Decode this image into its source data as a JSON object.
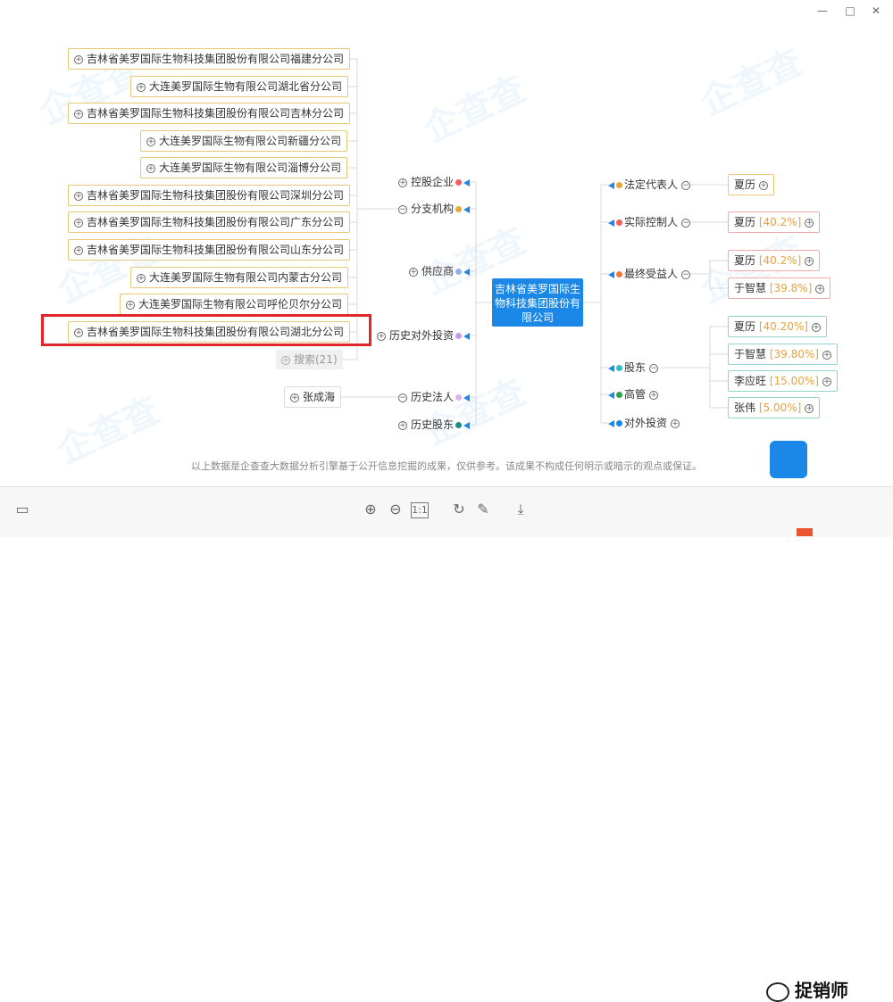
{
  "window": {
    "minimize": "—",
    "maximize": "□",
    "close": "✕"
  },
  "center_company": "吉林省美罗国际生物科技集团股份有限公司",
  "left_nodes": [
    "吉林省美罗国际生物科技集团股份有限公司福建分公司",
    "大连美罗国际生物有限公司湖北省分公司",
    "吉林省美罗国际生物科技集团股份有限公司吉林分公司",
    "大连美罗国际生物有限公司新疆分公司",
    "大连美罗国际生物有限公司淄博分公司",
    "吉林省美罗国际生物科技集团股份有限公司深圳分公司",
    "吉林省美罗国际生物科技集团股份有限公司广东分公司",
    "吉林省美罗国际生物科技集团股份有限公司山东分公司",
    "大连美罗国际生物有限公司内蒙古分公司",
    "大连美罗国际生物有限公司呼伦贝尔分公司",
    "吉林省美罗国际生物科技集团股份有限公司湖北分公司"
  ],
  "search_label": "搜索(21)",
  "left_categories": {
    "holding": "控股企业",
    "branch": "分支机构",
    "supplier": "供应商",
    "history_invest": "历史对外投资",
    "history_legal": "历史法人",
    "history_shareholder": "历史股东"
  },
  "history_legal_person": "张成海",
  "right_categories": {
    "legal_rep": "法定代表人",
    "controller": "实际控制人",
    "beneficiary": "最终受益人",
    "shareholder": "股东",
    "executives": "高管",
    "investment": "对外投资"
  },
  "legal_rep_name": "夏历",
  "controller": {
    "name": "夏历",
    "pct": "[40.2%]"
  },
  "beneficiaries": [
    {
      "name": "夏历",
      "pct": "[40.2%]"
    },
    {
      "name": "于智慧",
      "pct": "[39.8%]"
    }
  ],
  "shareholders": [
    {
      "name": "夏历",
      "pct": "[40.20%]"
    },
    {
      "name": "于智慧",
      "pct": "[39.80%]"
    },
    {
      "name": "李应旺",
      "pct": "[15.00%]"
    },
    {
      "name": "张伟",
      "pct": "[5.00%]"
    }
  ],
  "watermark": "企查查",
  "disclaimer": "以上数据是企查查大数据分析引擎基于公开信息挖掘的成果，仅供参考。该成果不构成任何明示或暗示的观点或保证。",
  "toolbar": {
    "fit_label": "1:1"
  },
  "brand": "捉销师",
  "colors": {
    "accent": "#1b87e6",
    "highlight": "#e0262b",
    "pct": "#e9a23b"
  }
}
